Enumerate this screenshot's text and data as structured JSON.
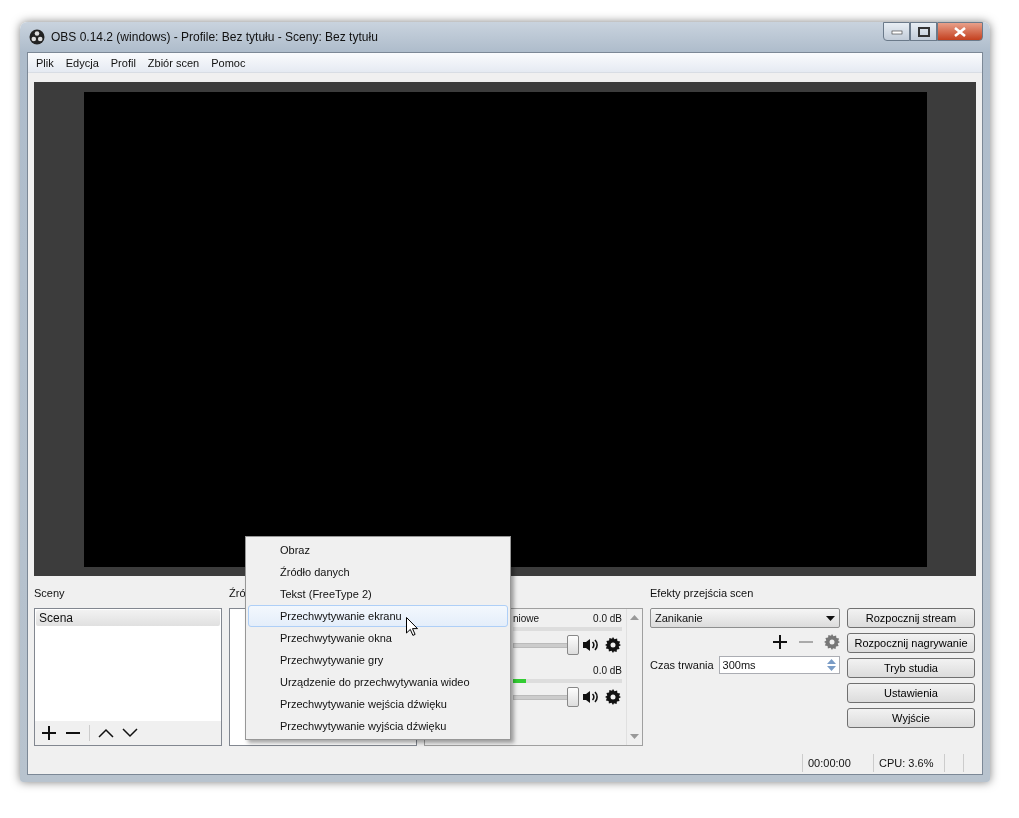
{
  "window": {
    "title": "OBS 0.14.2 (windows) - Profile: Bez tytułu - Sceny: Bez tytułu"
  },
  "menu": [
    "Plik",
    "Edycja",
    "Profil",
    "Zbiór scen",
    "Pomoc"
  ],
  "scenes": {
    "label": "Sceny",
    "items": [
      {
        "name": "Scena",
        "selected": true
      }
    ]
  },
  "sources": {
    "label": "Źró"
  },
  "mixer": {
    "channels": [
      {
        "name": "niowe",
        "reading": "0.0 dB",
        "level": 1.0
      },
      {
        "reading": "0.0 dB",
        "level": 1.0,
        "meter": {
          "level": 0.12
        }
      }
    ]
  },
  "transitions": {
    "label": "Efekty przejścia scen",
    "selected": "Zanikanie",
    "duration_label": "Czas trwania",
    "duration": "300ms"
  },
  "controls": [
    "Rozpocznij stream",
    "Rozpocznij nagrywanie",
    "Tryb studia",
    "Ustawienia",
    "Wyjście"
  ],
  "status_bar": {
    "time": "00:00:00",
    "cpu": "CPU: 3.6%"
  },
  "context_menu": {
    "items": [
      {
        "label": "Obraz",
        "selected": false
      },
      {
        "label": "Źródło danych",
        "selected": false
      },
      {
        "label": "Tekst (FreeType 2)",
        "selected": false
      },
      {
        "label": "Przechwytywanie ekranu",
        "selected": true
      },
      {
        "label": "Przechwytywanie okna",
        "selected": false
      },
      {
        "label": "Przechwytywanie gry",
        "selected": false
      },
      {
        "label": "Urządzenie do przechwytywania wideo",
        "selected": false
      },
      {
        "label": "Przechwytywanie wejścia dźwięku",
        "selected": false
      },
      {
        "label": "Przechwytywanie wyjścia dźwięku",
        "selected": false
      }
    ]
  }
}
